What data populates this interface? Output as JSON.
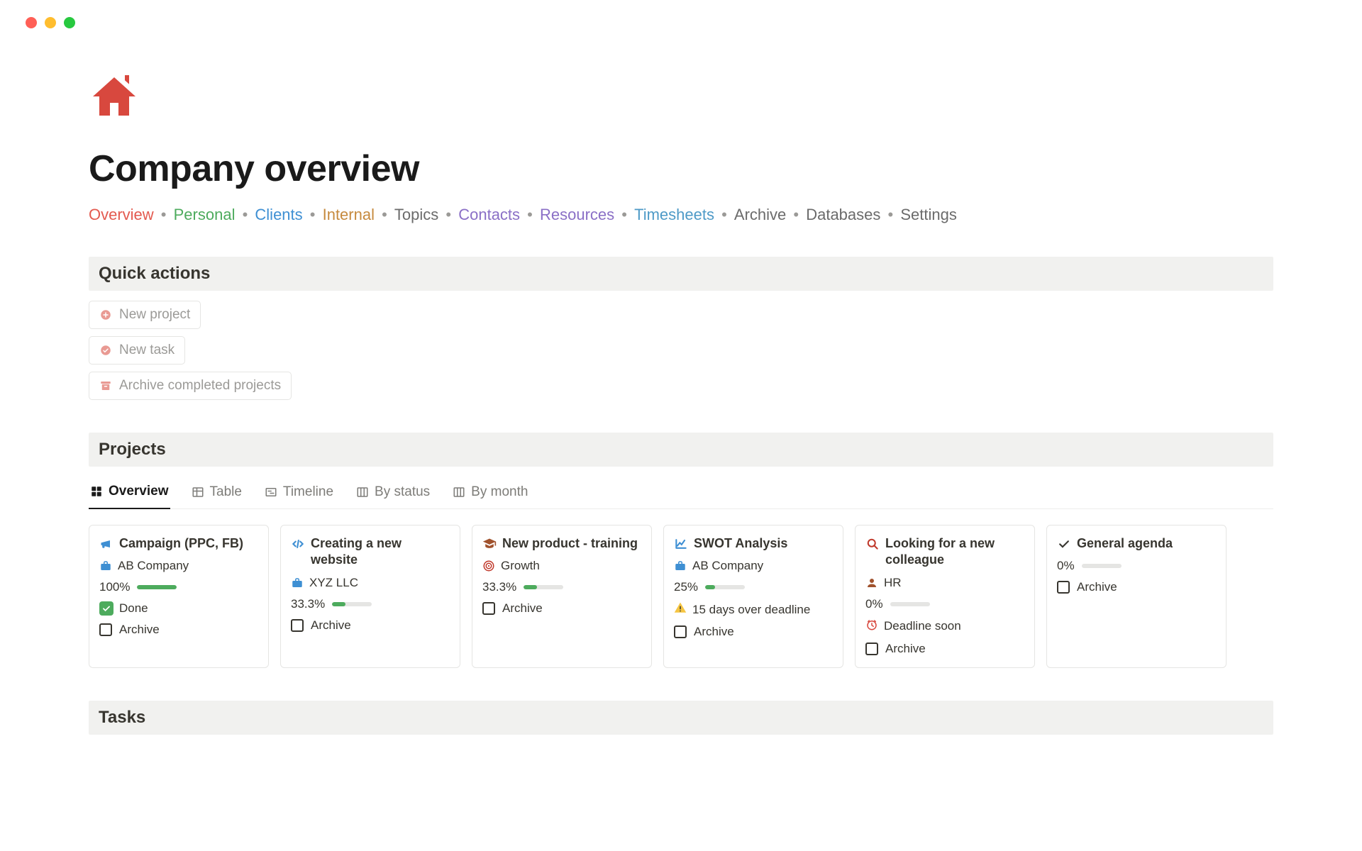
{
  "page": {
    "title": "Company overview"
  },
  "breadcrumb": {
    "items": [
      {
        "label": "Overview",
        "cls": "bc-overview"
      },
      {
        "label": "Personal",
        "cls": "bc-personal"
      },
      {
        "label": "Clients",
        "cls": "bc-clients"
      },
      {
        "label": "Internal",
        "cls": "bc-internal"
      },
      {
        "label": "Topics",
        "cls": "bc-topics"
      },
      {
        "label": "Contacts",
        "cls": "bc-contacts"
      },
      {
        "label": "Resources",
        "cls": "bc-resources"
      },
      {
        "label": "Timesheets",
        "cls": "bc-timesheets"
      },
      {
        "label": "Archive",
        "cls": "bc-archive"
      },
      {
        "label": "Databases",
        "cls": "bc-databases"
      },
      {
        "label": "Settings",
        "cls": "bc-settings"
      }
    ]
  },
  "sections": {
    "quick_actions": "Quick actions",
    "projects": "Projects",
    "tasks": "Tasks"
  },
  "quick_actions": [
    {
      "label": "New project",
      "icon": "plus-circle-icon"
    },
    {
      "label": "New task",
      "icon": "check-circle-icon"
    },
    {
      "label": "Archive completed projects",
      "icon": "archive-box-icon"
    }
  ],
  "tabs": [
    {
      "label": "Overview",
      "icon": "gallery-icon",
      "active": true
    },
    {
      "label": "Table",
      "icon": "table-icon"
    },
    {
      "label": "Timeline",
      "icon": "timeline-icon"
    },
    {
      "label": "By status",
      "icon": "board-icon"
    },
    {
      "label": "By month",
      "icon": "board-icon"
    }
  ],
  "archive_label": "Archive",
  "projects": [
    {
      "title": "Campaign (PPC, FB)",
      "icon": "megaphone-icon",
      "icon_color": "#3e8fd3",
      "client": "AB Company",
      "client_icon": "briefcase-icon",
      "client_color": "#3e8fd3",
      "progress_label": "100%",
      "progress": 100,
      "status_text": "Done",
      "status_icon": "done"
    },
    {
      "title": "Creating a new website",
      "icon": "code-icon",
      "icon_color": "#3e8fd3",
      "client": "XYZ LLC",
      "client_icon": "briefcase-icon",
      "client_color": "#3e8fd3",
      "progress_label": "33.3%",
      "progress": 33.3
    },
    {
      "title": "New product - training",
      "icon": "graduation-icon",
      "icon_color": "#a0522d",
      "client": "Growth",
      "client_icon": "target-icon",
      "client_color": "#c0392b",
      "progress_label": "33.3%",
      "progress": 33.3
    },
    {
      "title": "SWOT Analysis",
      "icon": "chart-icon",
      "icon_color": "#3e8fd3",
      "client": "AB Company",
      "client_icon": "briefcase-icon",
      "client_color": "#3e8fd3",
      "progress_label": "25%",
      "progress": 25,
      "status_text": "15 days over deadline",
      "status_icon": "warning"
    },
    {
      "title": "Looking for a new colleague",
      "icon": "search-icon",
      "icon_color": "#c0392b",
      "client": "HR",
      "client_icon": "person-icon",
      "client_color": "#a0522d",
      "progress_label": "0%",
      "progress": 0,
      "status_text": "Deadline soon",
      "status_icon": "clock"
    },
    {
      "title": "General agenda",
      "icon": "check-icon",
      "icon_color": "#37352f",
      "progress_label": "0%",
      "progress": 0
    }
  ]
}
